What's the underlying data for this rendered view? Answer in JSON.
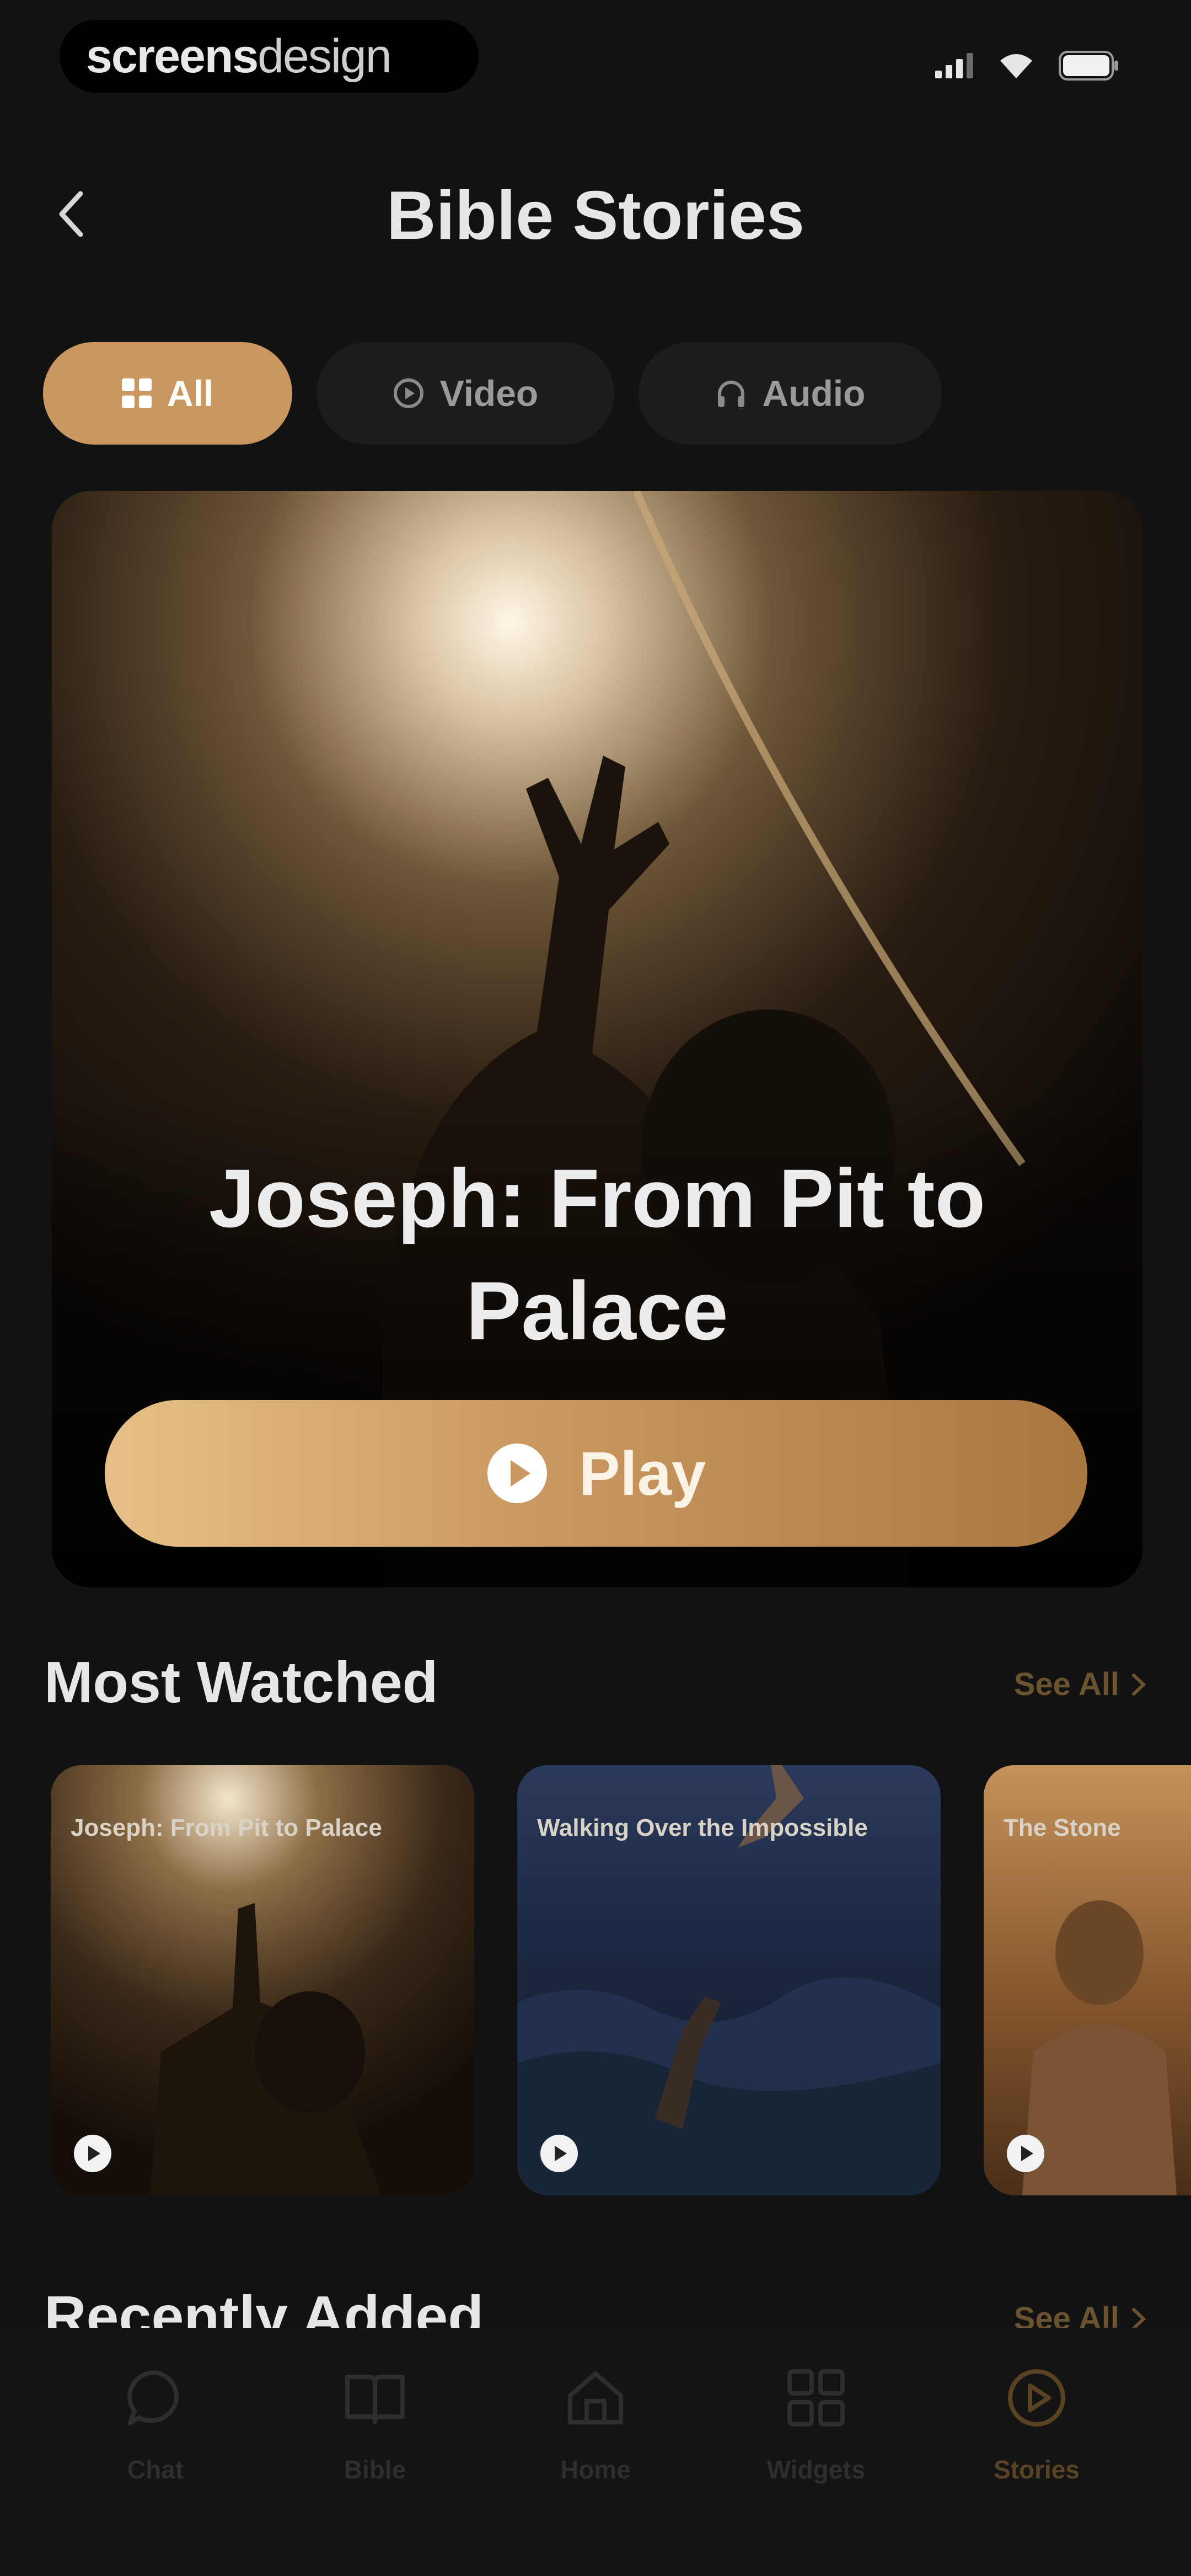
{
  "status_bar": {
    "brand_bold": "screens",
    "brand_light": "design"
  },
  "header": {
    "title": "Bible Stories"
  },
  "filters": [
    {
      "label": "All",
      "icon": "grid-icon",
      "active": true
    },
    {
      "label": "Video",
      "icon": "video-icon",
      "active": false
    },
    {
      "label": "Audio",
      "icon": "headphones-icon",
      "active": false
    }
  ],
  "hero": {
    "title": "Joseph: From Pit to Palace",
    "play_label": "Play"
  },
  "most_watched": {
    "title": "Most Watched",
    "see_all": "See All",
    "items": [
      {
        "title": "Joseph: From Pit to Palace"
      },
      {
        "title": "Walking Over the Impossible"
      },
      {
        "title": "The Stone"
      }
    ]
  },
  "recently_added": {
    "title": "Recently Added",
    "see_all": "See All"
  },
  "tabs": [
    {
      "label": "Chat",
      "icon": "chat-icon",
      "active": false
    },
    {
      "label": "Bible",
      "icon": "book-icon",
      "active": false
    },
    {
      "label": "Home",
      "icon": "home-icon",
      "active": false
    },
    {
      "label": "Widgets",
      "icon": "widgets-icon",
      "active": false
    },
    {
      "label": "Stories",
      "icon": "play-circle-icon",
      "active": true
    }
  ],
  "colors": {
    "accent": "#c9975f",
    "background": "#121212",
    "chip_inactive": "#1c1c1c"
  }
}
